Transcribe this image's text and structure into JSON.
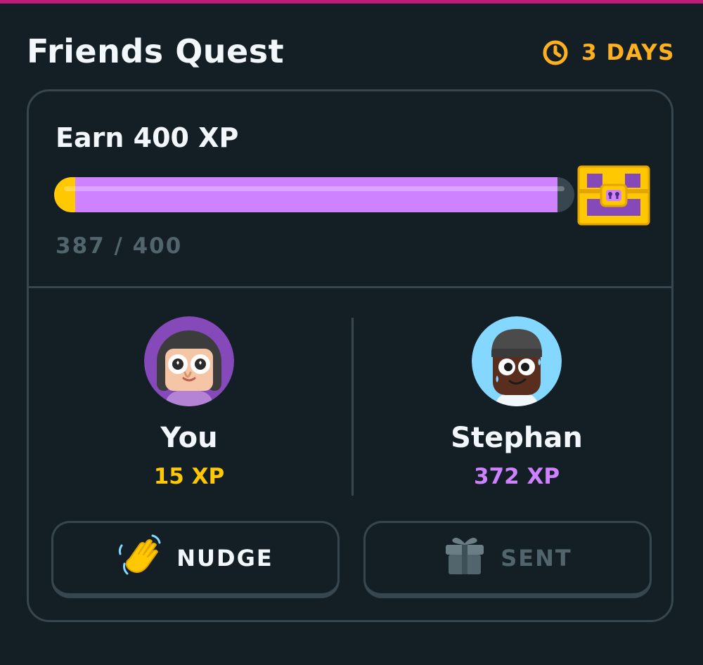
{
  "header": {
    "title": "Friends Quest",
    "timer_label": "3 DAYS",
    "timer_icon": "clock-icon",
    "accent_color": "#c21a79"
  },
  "quest": {
    "goal": "Earn 400 XP",
    "progress_text": "387 / 400",
    "progress_fraction": 0.9675,
    "reward_icon": "treasure-chest-icon"
  },
  "members": [
    {
      "name": "You",
      "xp": "15 XP",
      "xp_color": "#ffc800",
      "avatar_icon": "avatar-girl-icon"
    },
    {
      "name": "Stephan",
      "xp": "372 XP",
      "xp_color": "#ce82ff",
      "avatar_icon": "avatar-boy-icon"
    }
  ],
  "actions": {
    "nudge_label": "NUDGE",
    "nudge_icon": "waving-hand-icon",
    "sent_label": "SENT",
    "sent_icon": "gift-icon"
  }
}
